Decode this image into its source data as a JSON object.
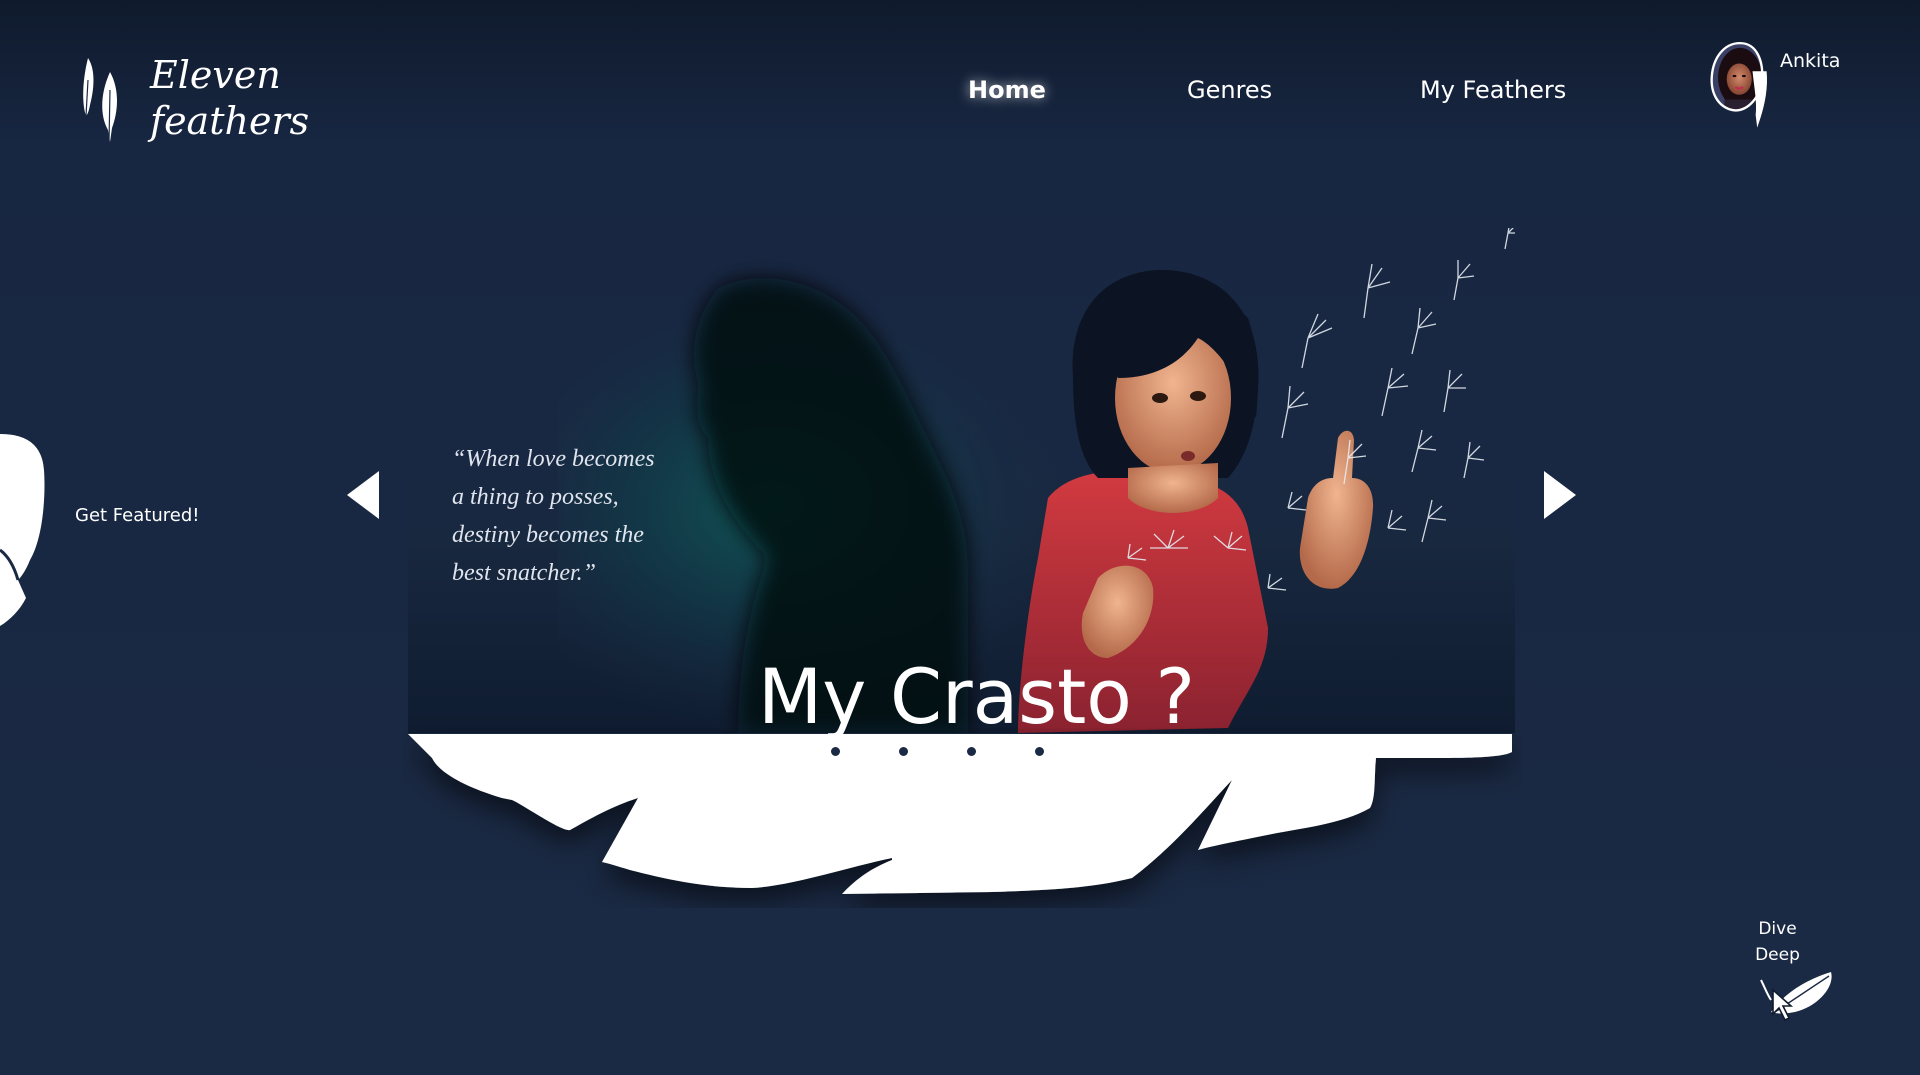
{
  "brand": {
    "line1": "Eleven",
    "line2": "feathers"
  },
  "nav": {
    "home": "Home",
    "genres": "Genres",
    "my_feathers": "My Feathers"
  },
  "user": {
    "name": "Ankita"
  },
  "side": {
    "get_featured": "Get Featured!"
  },
  "featured": {
    "quote_lines": [
      "“When love becomes",
      "a thing to posses,",
      "destiny becomes the",
      "best snatcher.”"
    ],
    "title": "My Crasto ?",
    "slide_count": 4
  },
  "dive": {
    "line1": "Dive",
    "line2": "Deep"
  },
  "colors": {
    "background": "#1b2a44",
    "accent": "#ffffff",
    "shirt": "#c2343c",
    "shadow_glow": "#0e5a58"
  }
}
